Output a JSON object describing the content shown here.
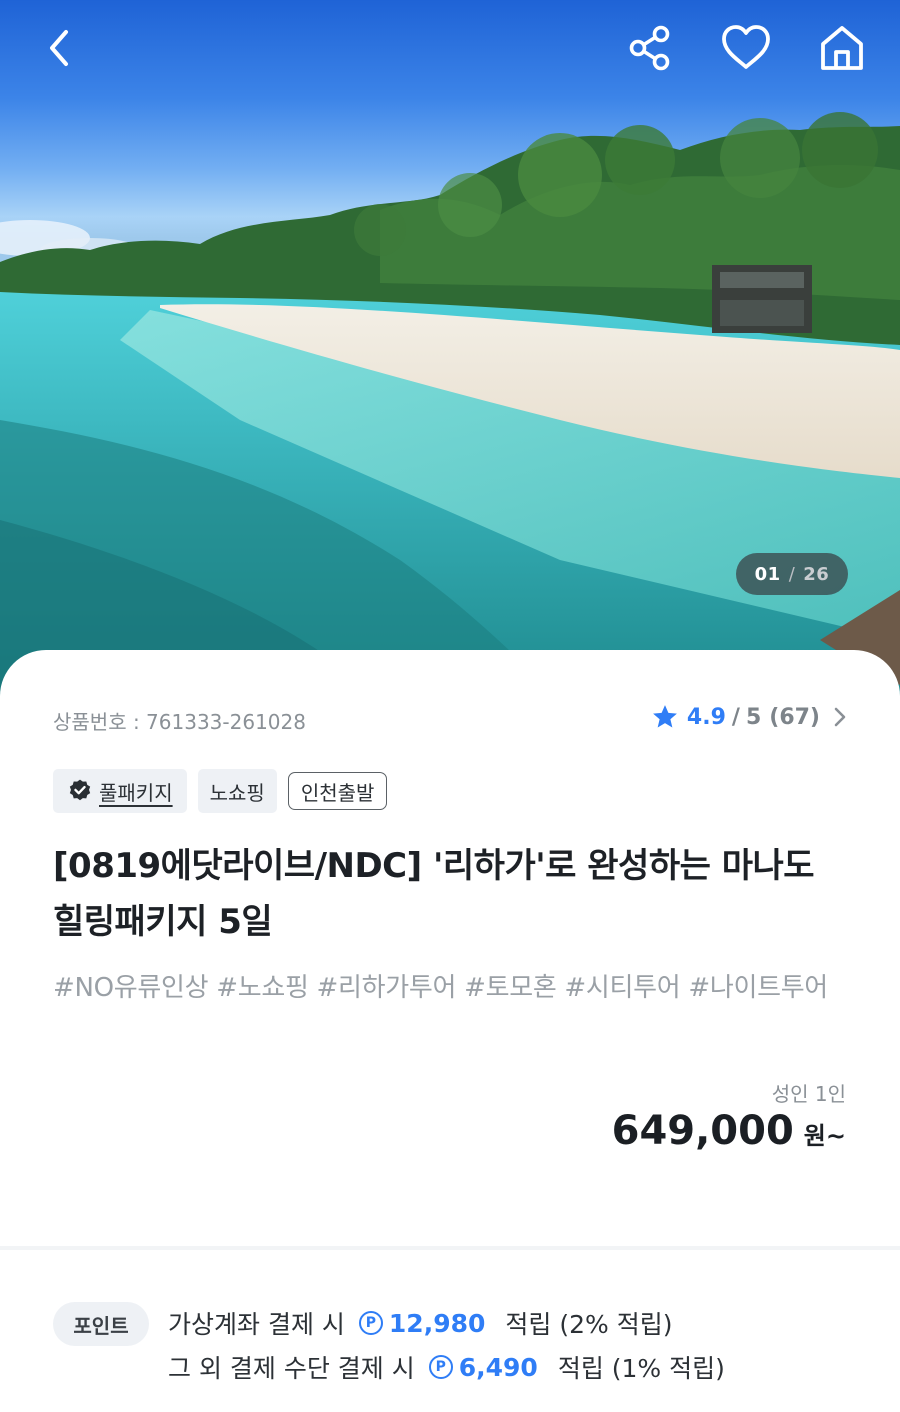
{
  "gallery": {
    "current": "01",
    "separator": "/",
    "total": "26"
  },
  "top_actions": {
    "back_icon": "chevron-left-icon",
    "share_icon": "share-icon",
    "wishlist_icon": "heart-outline-icon",
    "home_icon": "home-icon"
  },
  "product": {
    "number": "상품번호 : 761333-261028",
    "rating": {
      "score": "4.9",
      "of": "/",
      "max": "5",
      "count": "(67)"
    },
    "tags": {
      "full_package": "풀패키지",
      "no_shopping": "노쇼핑",
      "departure": "인천출발"
    },
    "title": "[0819에닷라이브/NDC] '리하가'로 완성하는 마나도 힐링패키지 5일",
    "hashtags": "#NO유류인상 #노쇼핑 #리하가투어 #토모혼 #시티투어 #나이트투어",
    "price": {
      "label": "성인 1인",
      "amount": "649,000",
      "unit": "원~"
    }
  },
  "points": {
    "badge": "포인트",
    "lines": [
      {
        "prefix": "가상계좌 결제 시",
        "icon": "P",
        "amount": "12,980",
        "suffix": "적립 (2% 적립)"
      },
      {
        "prefix": "그 외 결제 수단 결제 시",
        "icon": "P",
        "amount": "6,490",
        "suffix": "적립 (1% 적립)"
      }
    ]
  },
  "colors": {
    "accent_blue": "#2f7df6",
    "muted_text": "#8a9096",
    "title_text": "#1d2126"
  }
}
